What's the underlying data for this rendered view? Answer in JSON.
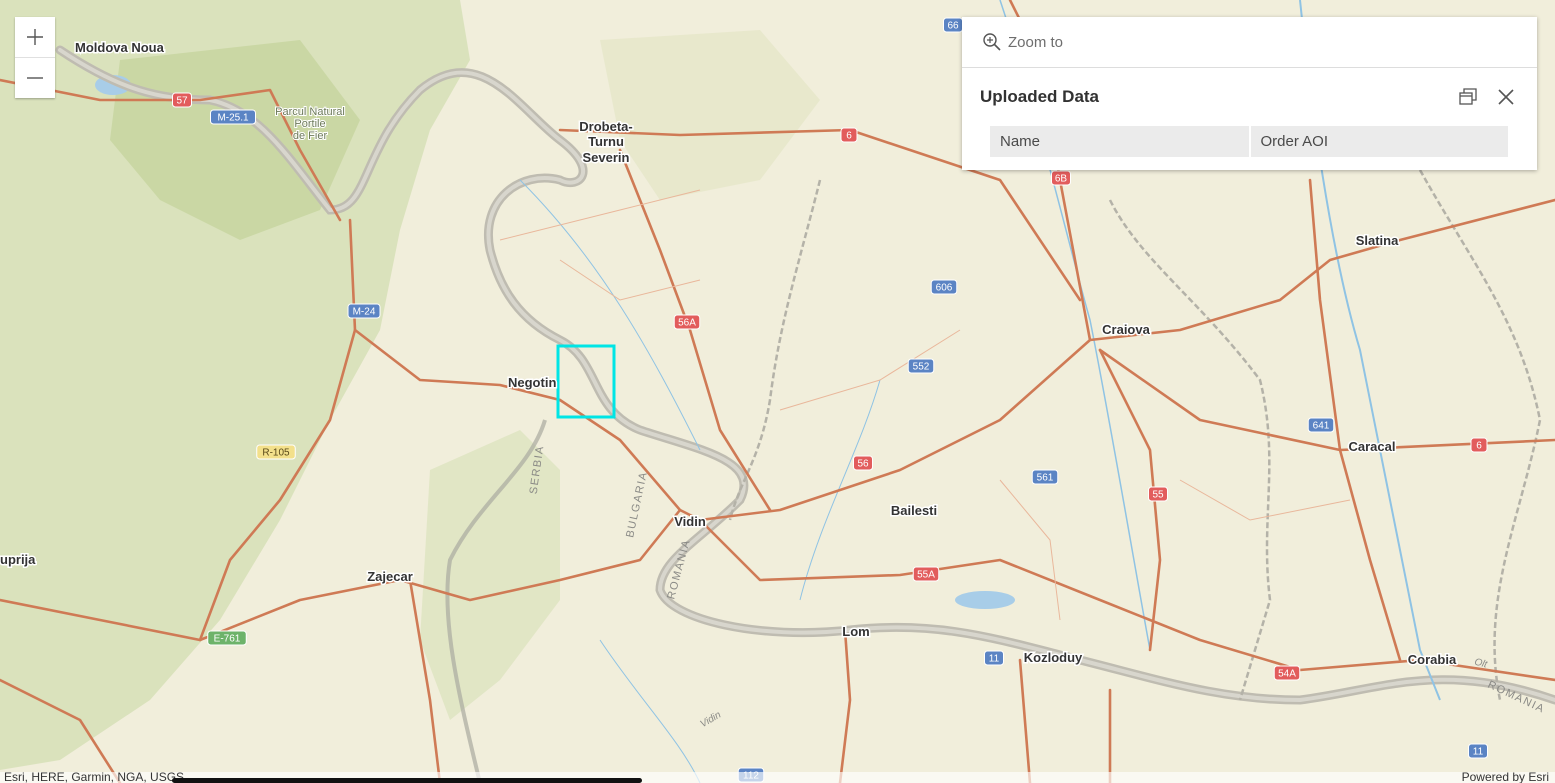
{
  "map": {
    "cities": [
      {
        "name": "Moldova Noua"
      },
      {
        "name": "Drobeta-"
      },
      {
        "name": "Turnu"
      },
      {
        "name": "Severin"
      },
      {
        "name": "Negotin"
      },
      {
        "name": "Vidin"
      },
      {
        "name": "Bailesti"
      },
      {
        "name": "Craiova"
      },
      {
        "name": "Slatina"
      },
      {
        "name": "Caracal"
      },
      {
        "name": "Zajecar"
      },
      {
        "name": "uprija"
      },
      {
        "name": "Lom"
      },
      {
        "name": "Kozloduy"
      },
      {
        "name": "Corabia"
      }
    ],
    "park_labels": [
      "Parcul Natural",
      "Portile",
      "de Fier"
    ],
    "country_labels": [
      "SERBIA",
      "BULGARIA",
      "ROMANIA",
      "ROMANIA"
    ],
    "minor_labels": [
      "Olt",
      "Vidin"
    ],
    "road_shields": [
      {
        "label": "57",
        "kind": "red"
      },
      {
        "label": "M-25.1",
        "kind": "blue"
      },
      {
        "label": "6",
        "kind": "red"
      },
      {
        "label": "66",
        "kind": "blue"
      },
      {
        "label": "6B",
        "kind": "red"
      },
      {
        "label": "606",
        "kind": "blue"
      },
      {
        "label": "56A",
        "kind": "red"
      },
      {
        "label": "M-24",
        "kind": "blue"
      },
      {
        "label": "552",
        "kind": "blue"
      },
      {
        "label": "R-105",
        "kind": "yellow"
      },
      {
        "label": "56",
        "kind": "red"
      },
      {
        "label": "561",
        "kind": "blue"
      },
      {
        "label": "641",
        "kind": "blue"
      },
      {
        "label": "6",
        "kind": "red"
      },
      {
        "label": "55",
        "kind": "red"
      },
      {
        "label": "55A",
        "kind": "red"
      },
      {
        "label": "E-761",
        "kind": "green"
      },
      {
        "label": "11",
        "kind": "blue"
      },
      {
        "label": "54A",
        "kind": "red"
      },
      {
        "label": "11",
        "kind": "blue"
      },
      {
        "label": "112",
        "kind": "blue"
      }
    ],
    "colors": {
      "land": "#f1eedb",
      "highland": "#d5dfb4",
      "road": "#cf7a55",
      "river": "#bfbcb1",
      "border": "#a9a9a0",
      "aoi": "#00e5e5",
      "water": "#a8cde8"
    }
  },
  "zoom": {
    "in_icon": "plus-icon",
    "out_icon": "minus-icon"
  },
  "popup": {
    "zoom_to_label": "Zoom to",
    "zoom_icon": "zoom-magnifier-icon",
    "title": "Uploaded Data",
    "dock_icon": "dock-icon",
    "close_icon": "close-icon",
    "fields": [
      {
        "name": "Name",
        "value": "Order AOI"
      }
    ]
  },
  "attribution": {
    "left": "Esri, HERE, Garmin, NGA, USGS",
    "right": "Powered by Esri"
  }
}
